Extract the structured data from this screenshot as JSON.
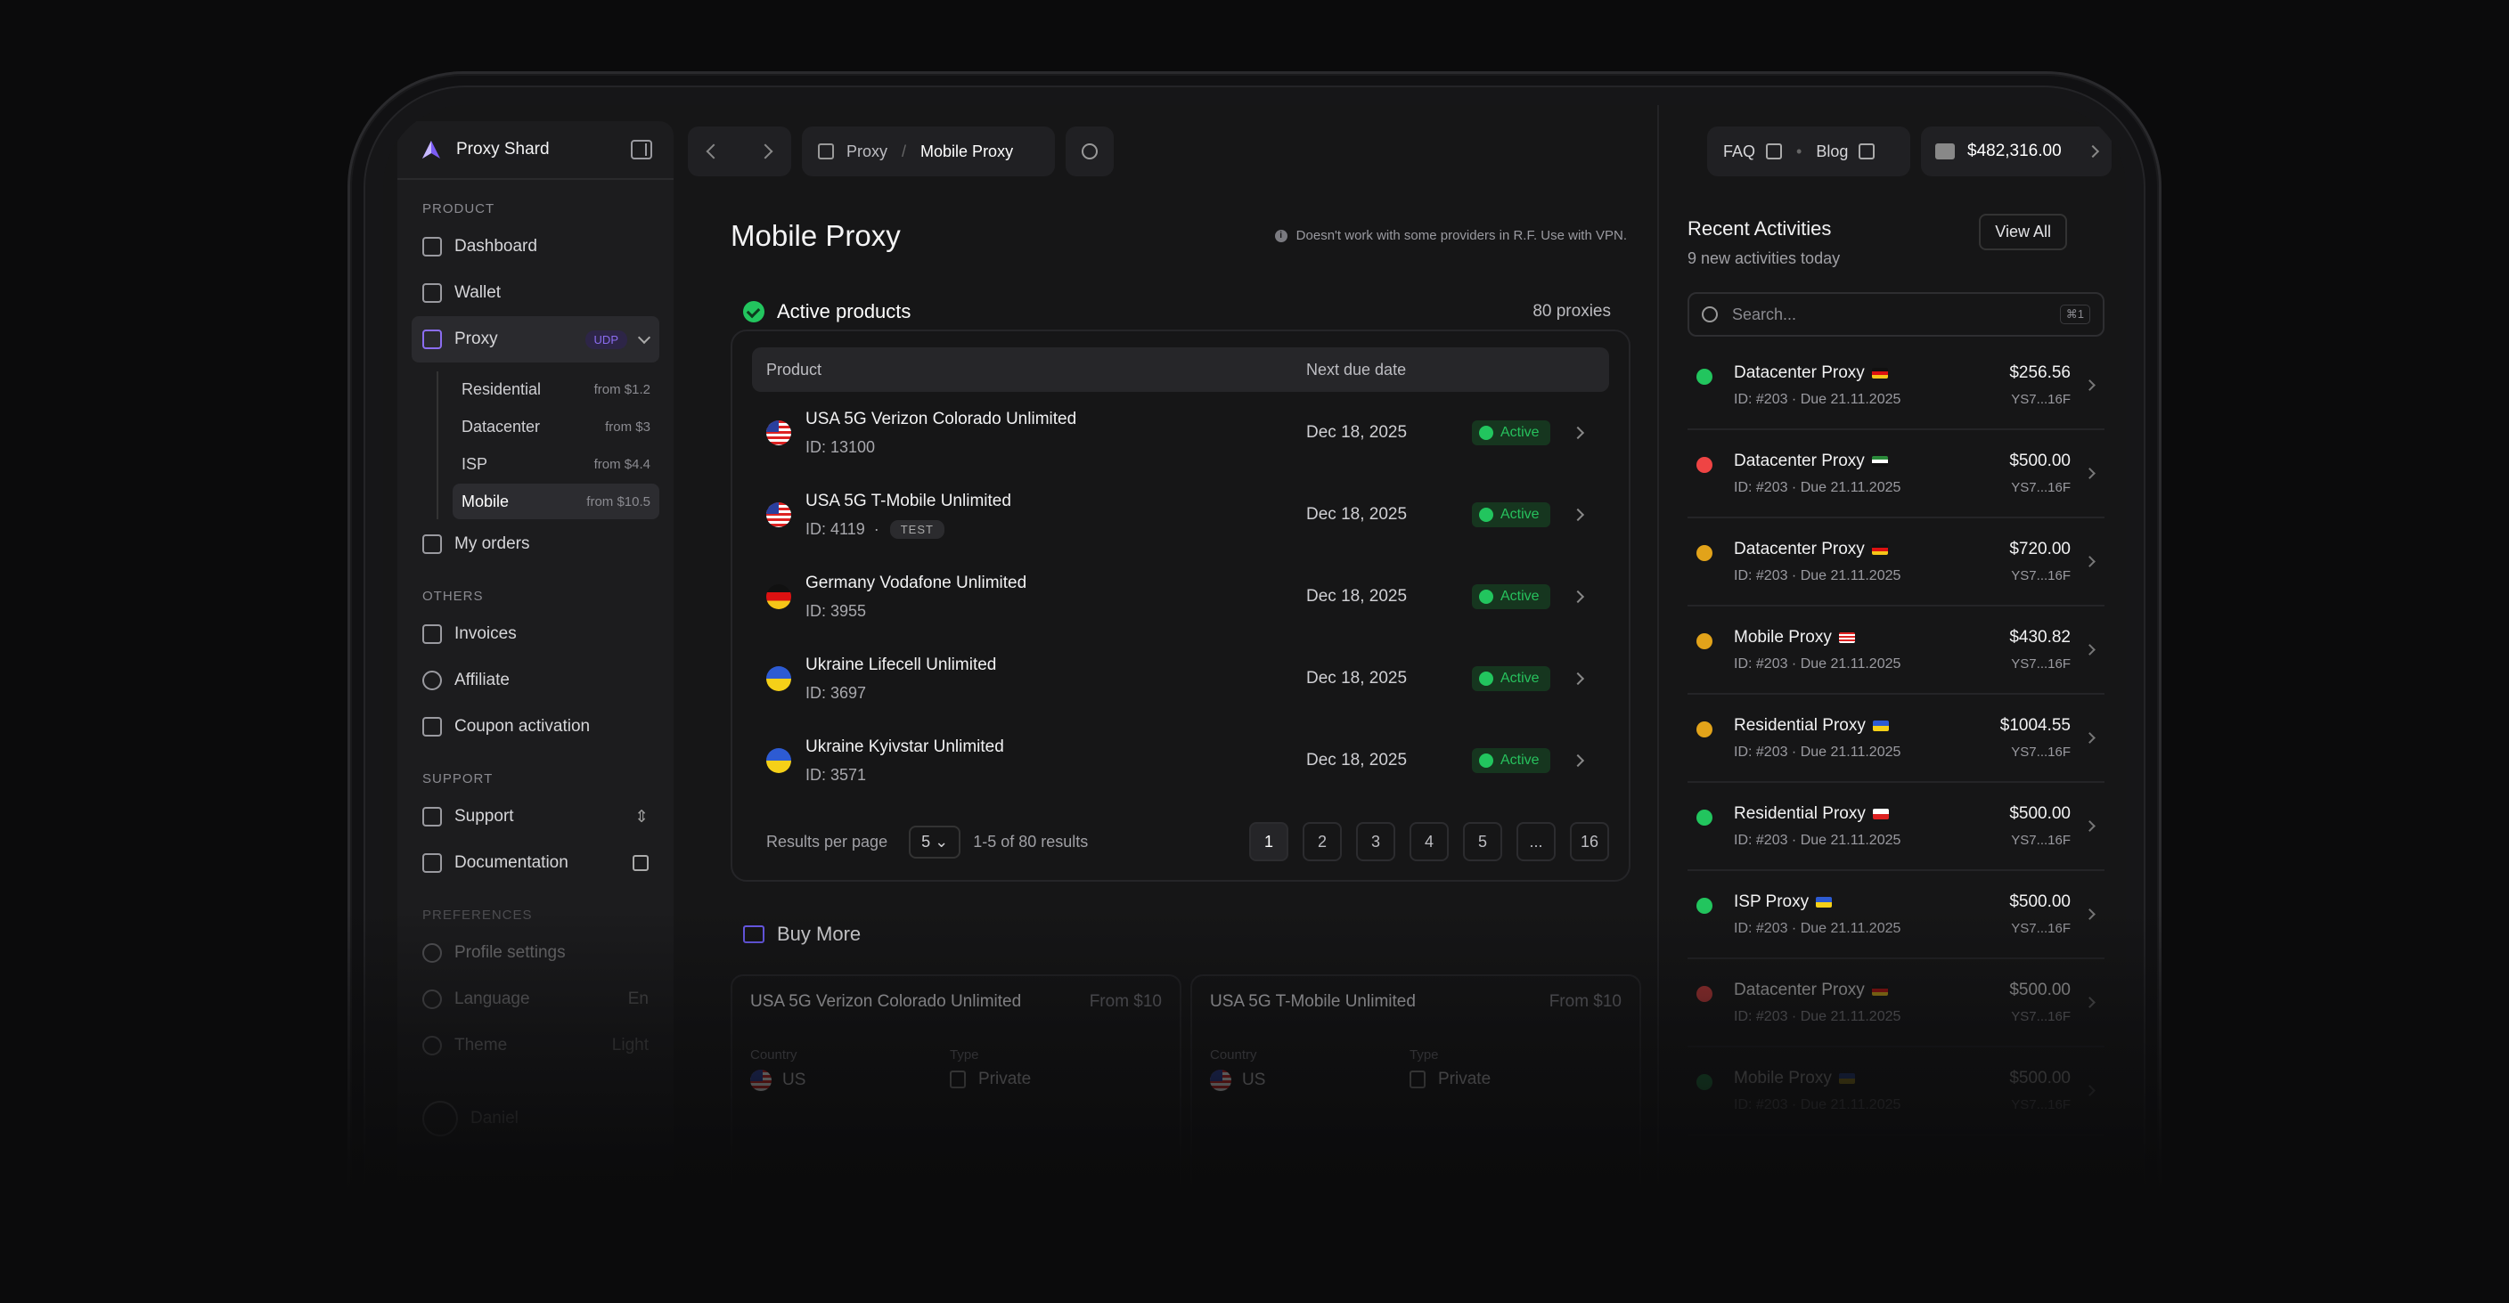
{
  "app": {
    "name": "Proxy Shard"
  },
  "sidebar": {
    "sections": {
      "product": "PRODUCT",
      "others": "OTHERS",
      "support": "SUPPORT",
      "preferences": "PREFERENCES"
    },
    "dashboard": "Dashboard",
    "wallet": "Wallet",
    "proxy": "Proxy",
    "udp": "UDP",
    "subitems": [
      {
        "label": "Residential",
        "price": "from $1.2"
      },
      {
        "label": "Datacenter",
        "price": "from $3"
      },
      {
        "label": "ISP",
        "price": "from $4.4"
      },
      {
        "label": "Mobile",
        "price": "from $10.5"
      }
    ],
    "orders": "My orders",
    "invoices": "Invoices",
    "affiliate": "Affiliate",
    "coupon": "Coupon activation",
    "support": "Support",
    "docs": "Documentation",
    "profile": "Profile settings",
    "language": "Language",
    "language_value": "En",
    "theme": "Theme",
    "theme_value": "Light",
    "user": "Daniel"
  },
  "topbar": {
    "crumb1": "Proxy",
    "sep": "/",
    "crumb2": "Mobile Proxy",
    "faq": "FAQ",
    "blog": "Blog",
    "balance": "$482,316.00"
  },
  "main": {
    "title": "Mobile Proxy",
    "note": "Doesn't work with some providers in R.F. Use with VPN.",
    "active_title": "Active products",
    "count": "80 proxies",
    "col_product": "Product",
    "col_due": "Next due date",
    "rows": [
      {
        "name": "USA 5G Verizon Colorado Unlimited",
        "id": "ID: 13100",
        "due": "Dec 18, 2025",
        "status": "Active"
      },
      {
        "name": "USA 5G T-Mobile Unlimited",
        "id": "ID: 4119",
        "tag": "TEST",
        "due": "Dec 18, 2025",
        "status": "Active"
      },
      {
        "name": "Germany Vodafone Unlimited",
        "id": "ID: 3955",
        "due": "Dec 18, 2025",
        "status": "Active"
      },
      {
        "name": "Ukraine Lifecell Unlimited",
        "id": "ID: 3697",
        "due": "Dec 18, 2025",
        "status": "Active"
      },
      {
        "name": "Ukraine Kyivstar Unlimited",
        "id": "ID: 3571",
        "due": "Dec 18, 2025",
        "status": "Active"
      }
    ],
    "rpp_label": "Results per page",
    "rpp": "5",
    "range": "1-5 of 80 results",
    "pages": [
      "1",
      "2",
      "3",
      "4",
      "5",
      "...",
      "16"
    ],
    "buy_title": "Buy More",
    "buy": [
      {
        "name": "USA 5G Verizon Colorado Unlimited",
        "from": "From $10",
        "country_k": "Country",
        "country": "US",
        "type_k": "Type",
        "type": "Private"
      },
      {
        "name": "USA 5G T-Mobile Unlimited",
        "from": "From $10",
        "country_k": "Country",
        "country": "US",
        "type_k": "Type",
        "type": "Private"
      }
    ]
  },
  "recent": {
    "title": "Recent Activities",
    "sub": "9 new activities today",
    "view_all": "View All",
    "search_ph": "Search...",
    "kbd": "⌘1",
    "items": [
      {
        "name": "Datacenter Proxy",
        "meta": "ID: #203 · Due 21.11.2025",
        "amount": "$256.56",
        "hash": "YS7...16F",
        "status": "ok"
      },
      {
        "name": "Datacenter Proxy",
        "meta": "ID: #203 · Due 21.11.2025",
        "amount": "$500.00",
        "hash": "YS7...16F",
        "status": "fail"
      },
      {
        "name": "Datacenter Proxy",
        "meta": "ID: #203 · Due 21.11.2025",
        "amount": "$720.00",
        "hash": "YS7...16F",
        "status": "pend"
      },
      {
        "name": "Mobile Proxy",
        "meta": "ID: #203 · Due 21.11.2025",
        "amount": "$430.82",
        "hash": "YS7...16F",
        "status": "pend"
      },
      {
        "name": "Residential Proxy",
        "meta": "ID: #203 · Due 21.11.2025",
        "amount": "$1004.55",
        "hash": "YS7...16F",
        "status": "pend"
      },
      {
        "name": "Residential Proxy",
        "meta": "ID: #203 · Due 21.11.2025",
        "amount": "$500.00",
        "hash": "YS7...16F",
        "status": "ok"
      },
      {
        "name": "ISP Proxy",
        "meta": "ID: #203 · Due 21.11.2025",
        "amount": "$500.00",
        "hash": "YS7...16F",
        "status": "ok"
      },
      {
        "name": "Datacenter Proxy",
        "meta": "ID: #203 · Due 21.11.2025",
        "amount": "$500.00",
        "hash": "YS7...16F",
        "status": "fail"
      },
      {
        "name": "Mobile Proxy",
        "meta": "ID: #203 · Due 21.11.2025",
        "amount": "$500.00",
        "hash": "YS7...16F",
        "status": "ok"
      }
    ]
  },
  "colors": {
    "accent": "#8b6df0",
    "success": "#22c55e",
    "error": "#ef4444",
    "pending": "#e2a31a"
  }
}
